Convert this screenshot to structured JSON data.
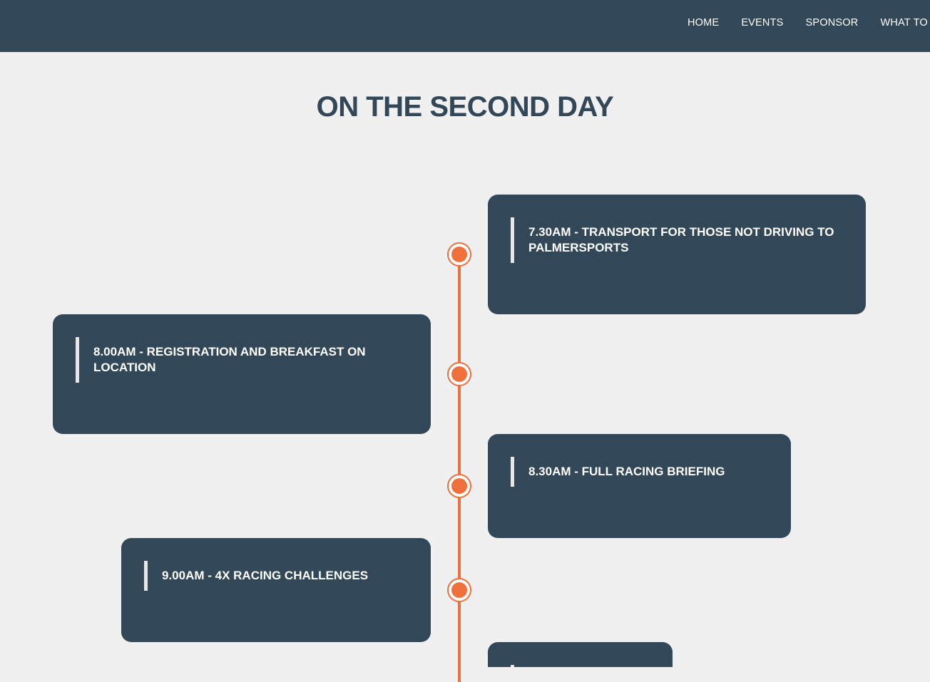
{
  "nav": {
    "items": [
      "HOME",
      "EVENTS",
      "SPONSOR",
      "WHAT TO"
    ]
  },
  "page": {
    "title": "ON THE SECOND DAY"
  },
  "timeline": {
    "events": [
      "7.30AM - TRANSPORT FOR THOSE NOT DRIVING TO PALMERSPORTS",
      "8.00AM - REGISTRATION AND BREAKFAST ON LOCATION",
      "8.30AM - FULL RACING BRIEFING",
      "9.00AM - 4X RACING CHALLENGES",
      ""
    ]
  },
  "colors": {
    "header": "#324757",
    "accent": "#ef703b",
    "background": "#f0f0f0",
    "card": "#324757"
  },
  "icons": [
    "timeline-dot-icon"
  ]
}
